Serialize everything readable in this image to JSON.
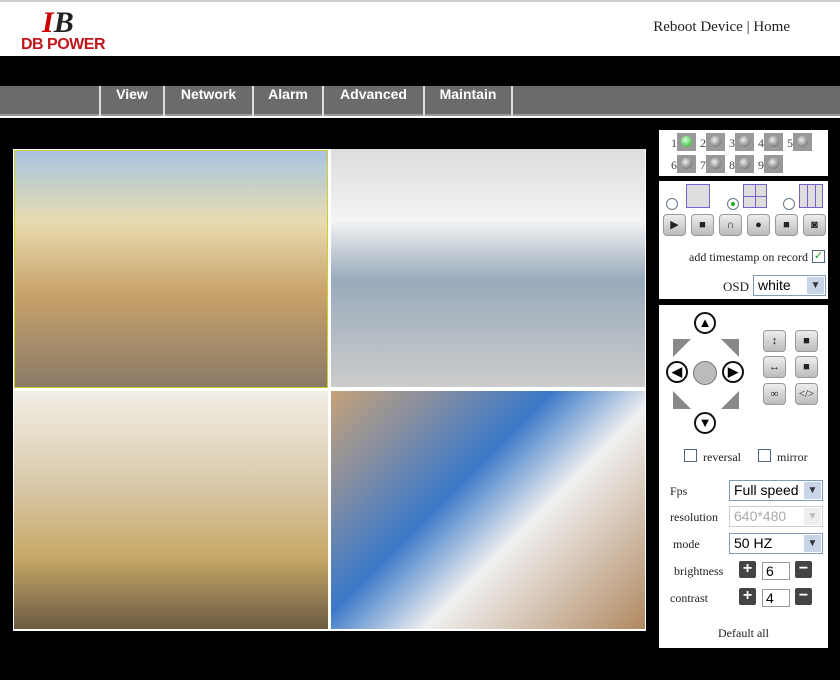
{
  "header": {
    "logo_mark": "B",
    "logo_text": "DB POWER",
    "links": [
      "Reboot Device",
      "Home"
    ],
    "separator": "|"
  },
  "nav": [
    "View",
    "Network",
    "Alarm",
    "Advanced",
    "Maintain"
  ],
  "channels": [
    {
      "n": "1",
      "active": true
    },
    {
      "n": "2"
    },
    {
      "n": "3"
    },
    {
      "n": "4"
    },
    {
      "n": "5"
    },
    {
      "n": "6"
    },
    {
      "n": "7"
    },
    {
      "n": "8"
    },
    {
      "n": "9"
    }
  ],
  "layout": {
    "selected": "4-split"
  },
  "controls": {
    "timestamp_label": "add timestamp on record",
    "timestamp_checked": true,
    "osd_label": "OSD",
    "osd_value": "white"
  },
  "ptz": {
    "reversal": "reversal",
    "mirror": "mirror"
  },
  "settings": {
    "fps_label": "Fps",
    "fps_value": "Full speed",
    "resolution_label": "resolution",
    "resolution_value": "640*480",
    "mode_label": "mode",
    "mode_value": "50 HZ",
    "brightness_label": "brightness",
    "brightness_value": "6",
    "contrast_label": "contrast",
    "contrast_value": "4",
    "default_label": "Default all"
  },
  "colors": {
    "nav_bg": "#6b6b6b",
    "logo_red": "#c0161c",
    "active_channel": "#2a2"
  }
}
